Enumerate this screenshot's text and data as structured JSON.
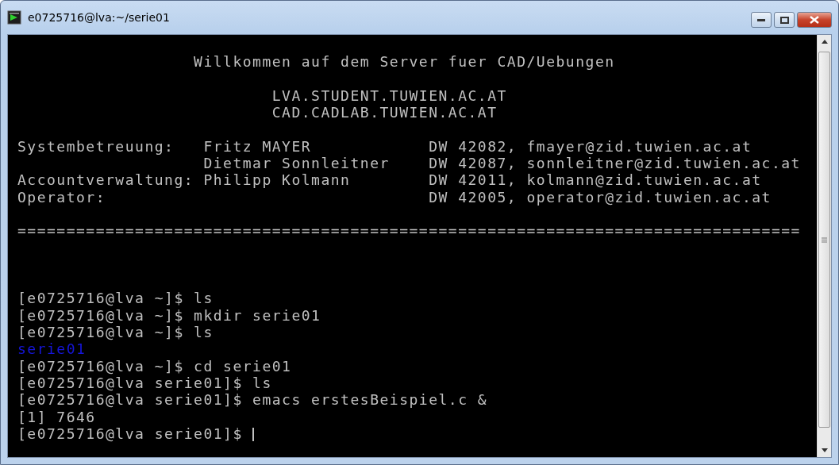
{
  "window": {
    "title": "e0725716@lva:~/serie01"
  },
  "terminal": {
    "lines": [
      {
        "kind": "blank"
      },
      {
        "kind": "output",
        "text": "                  Willkommen auf dem Server fuer CAD/Uebungen"
      },
      {
        "kind": "blank"
      },
      {
        "kind": "output",
        "text": "                          LVA.STUDENT.TUWIEN.AC.AT"
      },
      {
        "kind": "output",
        "text": "                          CAD.CADLAB.TUWIEN.AC.AT"
      },
      {
        "kind": "blank"
      },
      {
        "kind": "output",
        "text": "Systembetreuung:   Fritz MAYER            DW 42082, fmayer@zid.tuwien.ac.at"
      },
      {
        "kind": "output",
        "text": "                   Dietmar Sonnleitner    DW 42087, sonnleitner@zid.tuwien.ac.at"
      },
      {
        "kind": "output",
        "text": "Accountverwaltung: Philipp Kolmann        DW 42011, kolmann@zid.tuwien.ac.at"
      },
      {
        "kind": "output",
        "text": "Operator:                                 DW 42005, operator@zid.tuwien.ac.at"
      },
      {
        "kind": "blank"
      },
      {
        "kind": "output",
        "text": "================================================================================"
      },
      {
        "kind": "blank"
      },
      {
        "kind": "blank"
      },
      {
        "kind": "blank"
      },
      {
        "kind": "output",
        "text": "[e0725716@lva ~]$ ls"
      },
      {
        "kind": "output",
        "text": "[e0725716@lva ~]$ mkdir serie01"
      },
      {
        "kind": "output",
        "text": "[e0725716@lva ~]$ ls"
      },
      {
        "kind": "directory",
        "text": "serie01"
      },
      {
        "kind": "output",
        "text": "[e0725716@lva ~]$ cd serie01"
      },
      {
        "kind": "output",
        "text": "[e0725716@lva serie01]$ ls"
      },
      {
        "kind": "output",
        "text": "[e0725716@lva serie01]$ emacs erstesBeispiel.c &"
      },
      {
        "kind": "output",
        "text": "[1] 7646"
      },
      {
        "kind": "input",
        "text": "[e0725716@lva serie01]$ "
      }
    ]
  }
}
